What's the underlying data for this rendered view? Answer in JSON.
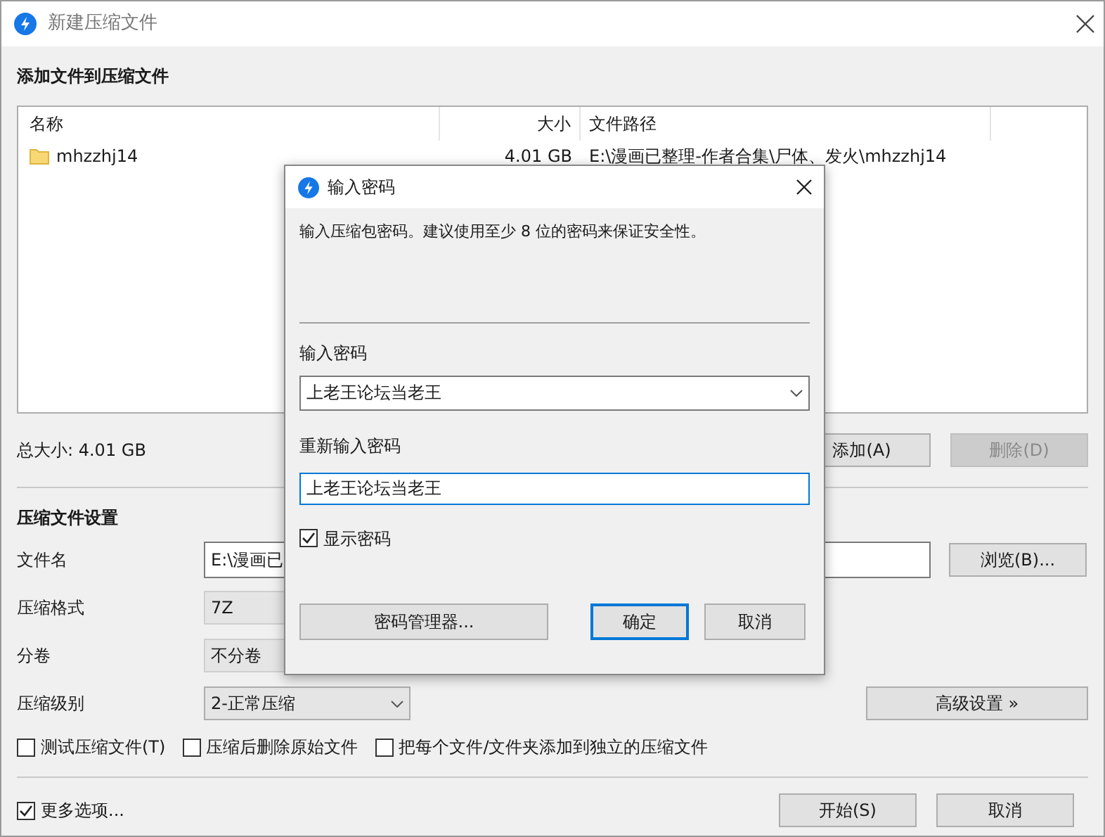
{
  "window": {
    "title": "新建压缩文件"
  },
  "files_section": {
    "heading": "添加文件到压缩文件",
    "columns": [
      "名称",
      "大小",
      "文件路径"
    ],
    "rows": [
      {
        "name": "mhzzhj14",
        "size": "4.01 GB",
        "path": "E:\\漫画已整理-作者合集\\尸体、发火\\mhzzhj14"
      }
    ],
    "total": "总大小: 4.01 GB",
    "buttons": [
      {
        "label": "添加(A)",
        "disabled": false
      },
      {
        "label": "删除(D)",
        "disabled": true
      }
    ]
  },
  "settings": {
    "heading": "压缩文件设置",
    "filename": {
      "label": "文件名",
      "value": "E:\\漫画已",
      "button": "浏览(B)..."
    },
    "format": {
      "label": "压缩格式",
      "value": "7Z"
    },
    "split": {
      "label": "分卷",
      "value": "不分卷"
    },
    "level": {
      "label": "压缩级别",
      "value": "2-正常压缩"
    },
    "advanced_button": "高级设置 »",
    "options": [
      {
        "label": "测试压缩文件(T)",
        "checked": false
      },
      {
        "label": "压缩后删除原始文件",
        "checked": false
      },
      {
        "label": "把每个文件/文件夹添加到独立的压缩文件",
        "checked": false
      }
    ]
  },
  "more_options": {
    "label": "更多选项...",
    "checked": true
  },
  "footer_buttons": [
    "开始(S)",
    "取消"
  ],
  "dialog": {
    "title": "输入密码",
    "message": "输入压缩包密码。建议使用至少 8 位的密码来保证安全性。",
    "password_label": "输入密码",
    "password_value": "上老王论坛当老王",
    "confirm_label": "重新输入密码",
    "confirm_value": "上老王论坛当老王",
    "show_password": {
      "label": "显示密码",
      "checked": true
    },
    "buttons": [
      {
        "label": "密码管理器...",
        "default": false
      },
      {
        "label": "确定",
        "default": true
      },
      {
        "label": "取消",
        "default": false
      }
    ]
  }
}
